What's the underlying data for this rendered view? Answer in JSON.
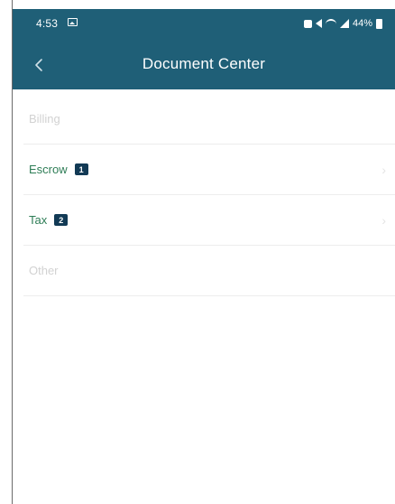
{
  "status_bar": {
    "time": "4:53",
    "battery": "44%",
    "icons": [
      "gallery-icon",
      "recording-icon",
      "mute-icon",
      "wifi-icon",
      "signal-icon",
      "battery-icon"
    ]
  },
  "app_bar": {
    "back_icon": "chevron-left-icon",
    "title": "Document Center"
  },
  "colors": {
    "primary": "#1f5f77",
    "badge": "#123a55",
    "enabled_label": "#2e7d56",
    "disabled_label": "#d2d2d2"
  },
  "documents": [
    {
      "label": "Billing",
      "count": null,
      "enabled": false
    },
    {
      "label": "Escrow",
      "count": "1",
      "enabled": true
    },
    {
      "label": "Tax",
      "count": "2",
      "enabled": true
    },
    {
      "label": "Other",
      "count": null,
      "enabled": false
    }
  ]
}
